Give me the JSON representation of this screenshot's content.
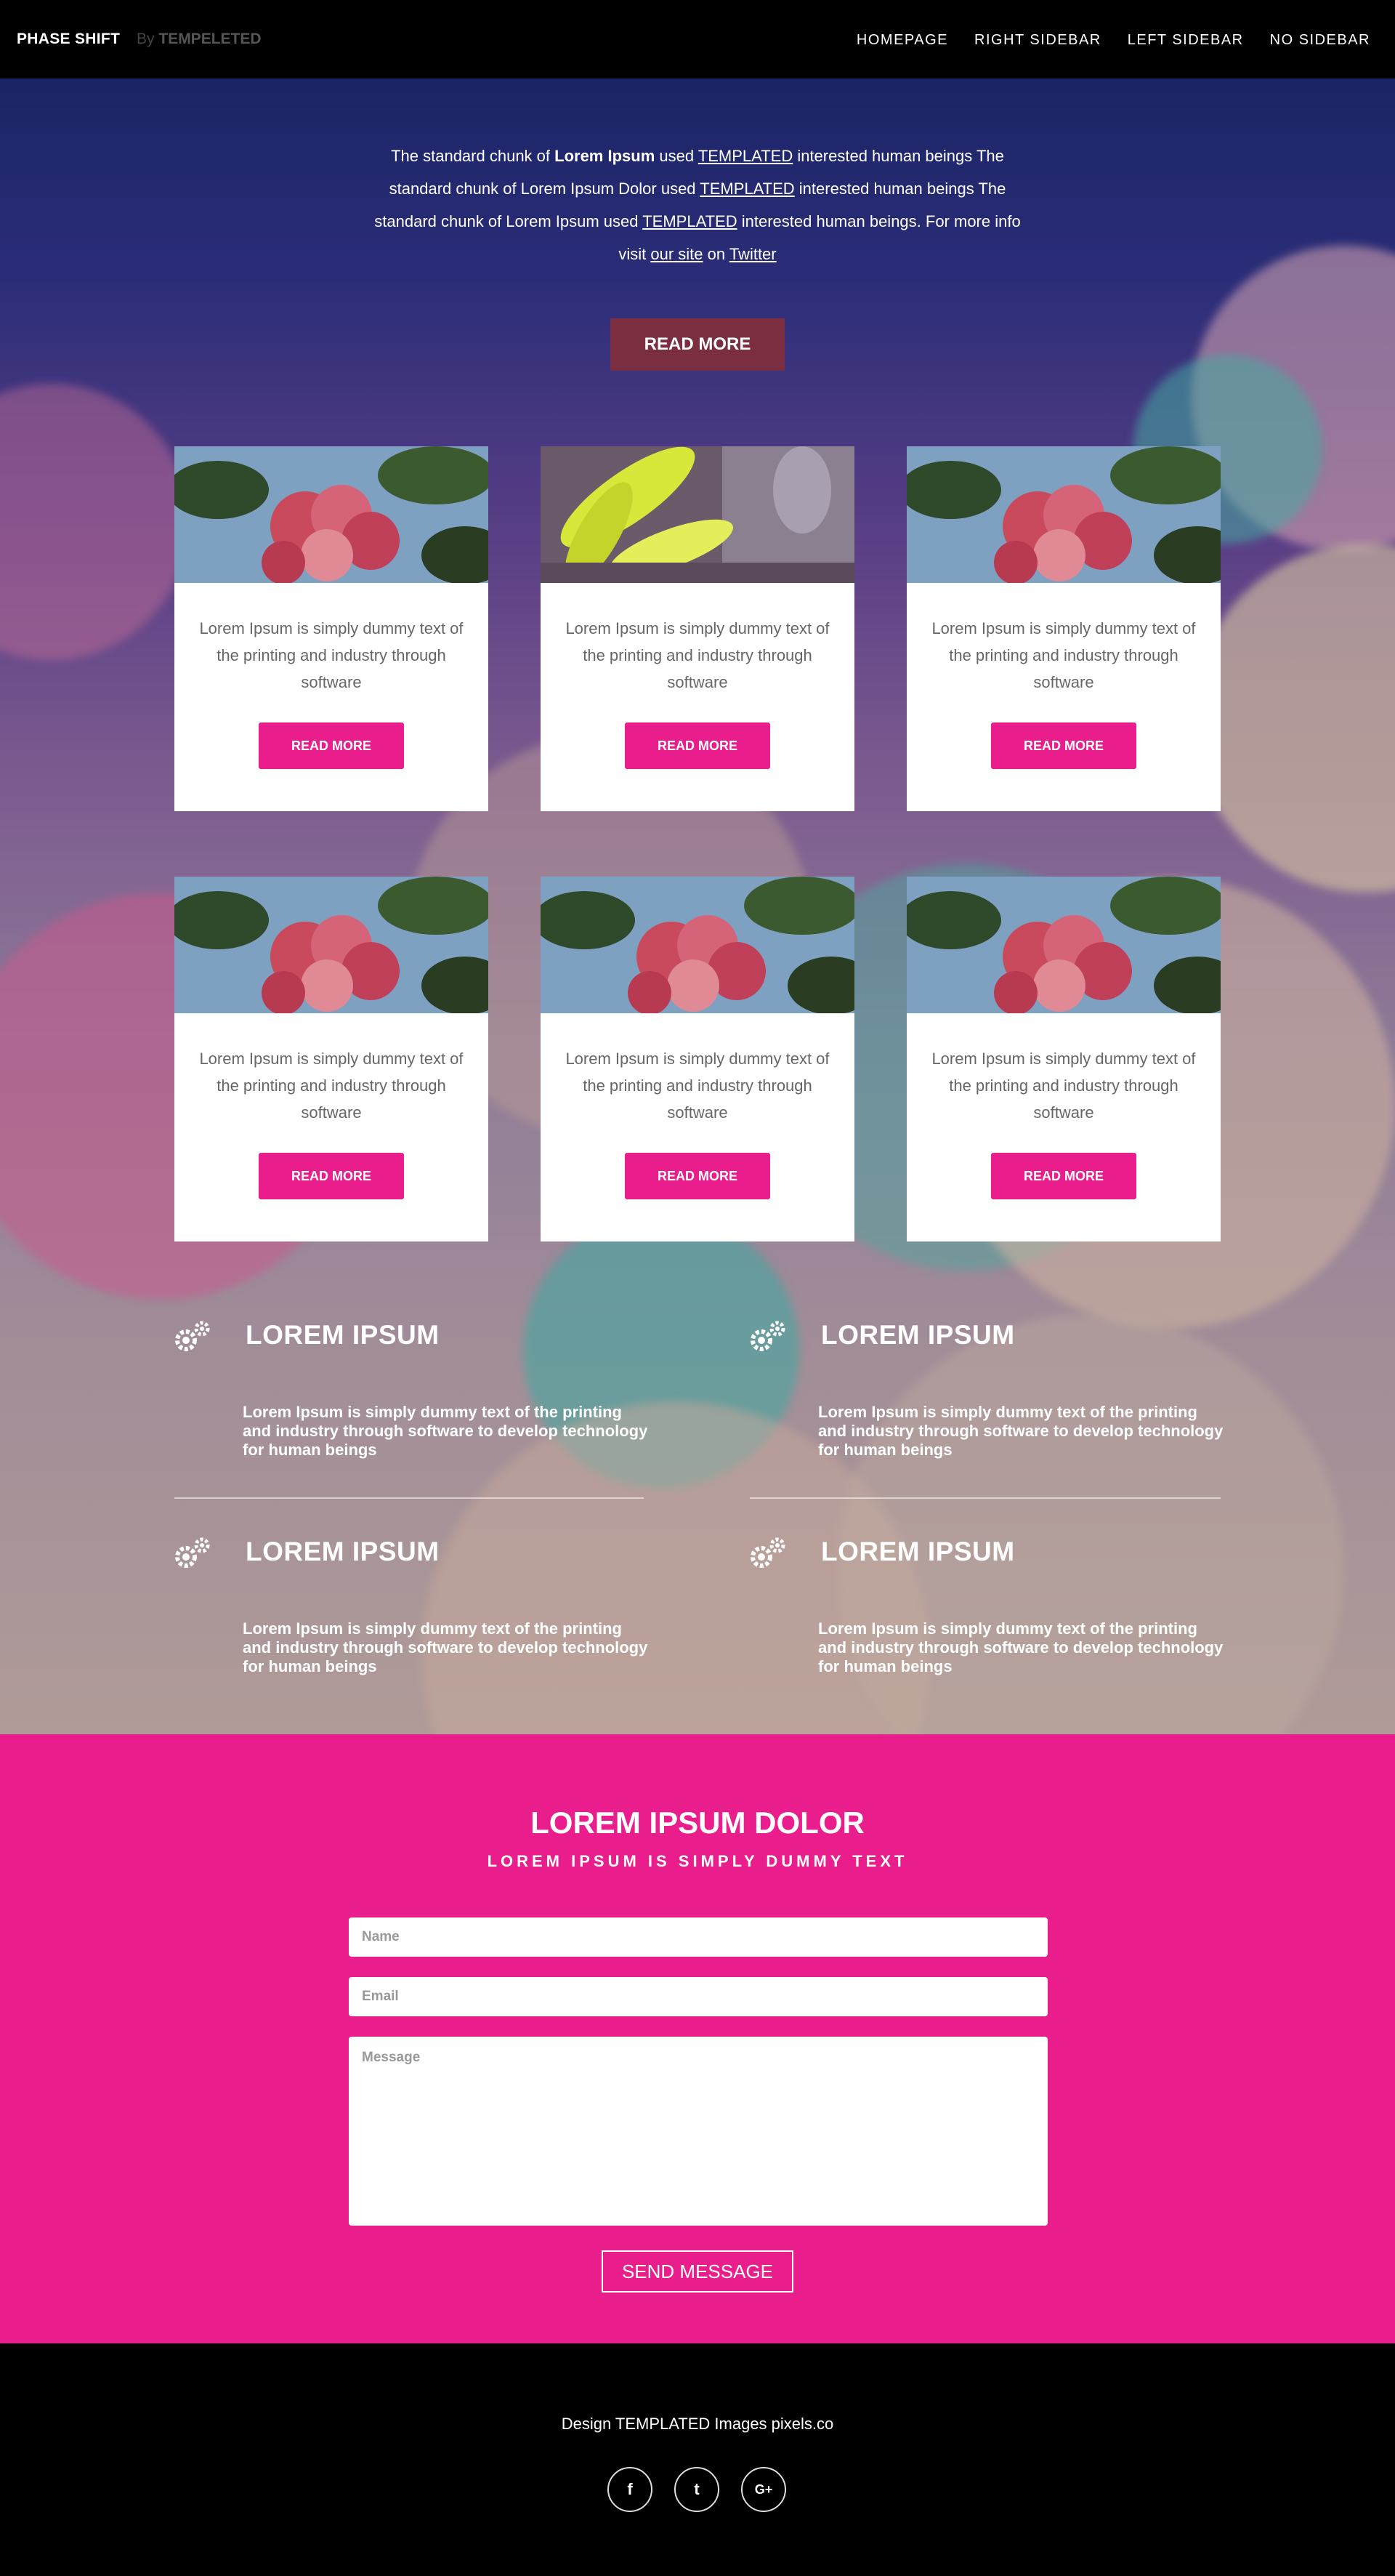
{
  "nav": {
    "brand": "PHASE SHIFT",
    "by_prefix": "By",
    "by_name": "TEMPELETED",
    "items": [
      "HOMEPAGE",
      "RIGHT SIDEBAR",
      "LEFT SIDEBAR",
      "NO SIDEBAR"
    ]
  },
  "hero": {
    "p1": "The standard chunk of ",
    "p1_bold": "Lorem Ipsum",
    "p2": " used ",
    "link1": "TEMPLATED",
    "p3": " interested human beings The standard chunk of Lorem Ipsum Dolor used ",
    "link2": "TEMPLATED",
    "p4": " interested human beings The standard chunk of Lorem Ipsum used ",
    "link3": "TEMPLATED",
    "p5": " interested human beings. For more info visit ",
    "link_site": "our site",
    "p6": " on ",
    "link_twitter": "Twitter",
    "button": "READ MORE"
  },
  "cards": [
    {
      "text": "Lorem Ipsum is simply dummy text of the printing and industry through software",
      "button": "READ MORE",
      "image": "pink-flower"
    },
    {
      "text": "Lorem Ipsum is simply dummy text of the printing and industry through software",
      "button": "READ MORE",
      "image": "yellow-leaves"
    },
    {
      "text": "Lorem Ipsum is simply dummy text of the printing and industry through software",
      "button": "READ MORE",
      "image": "pink-flower"
    },
    {
      "text": "Lorem Ipsum is simply dummy text of the printing and industry through software",
      "button": "READ MORE",
      "image": "pink-flower"
    },
    {
      "text": "Lorem Ipsum is simply dummy text of the printing and industry through software",
      "button": "READ MORE",
      "image": "pink-flower"
    },
    {
      "text": "Lorem Ipsum is simply dummy text of the printing and industry through software",
      "button": "READ MORE",
      "image": "pink-flower"
    }
  ],
  "features": [
    {
      "icon": "gears-icon",
      "title": "LOREM IPSUM",
      "text": "Lorem Ipsum is simply dummy text of the printing and industry through software to develop technology for human beings"
    },
    {
      "icon": "gears-icon",
      "title": "LOREM IPSUM",
      "text": "Lorem Ipsum is simply dummy text of the printing and industry through software to develop technology for human beings"
    },
    {
      "icon": "gears-icon",
      "title": "LOREM IPSUM",
      "text": "Lorem Ipsum is simply dummy text of the printing and industry through software to develop technology for human beings"
    },
    {
      "icon": "gears-icon",
      "title": "LOREM IPSUM",
      "text": "Lorem Ipsum is simply dummy text of the printing and industry through software to develop technology for human beings"
    }
  ],
  "contact": {
    "title": "LOREM IPSUM DOLOR",
    "subtitle": "LOREM IPSUM IS SIMPLY DUMMY TEXT",
    "name_placeholder": "Name",
    "email_placeholder": "Email",
    "message_placeholder": "Message",
    "send": "SEND MESSAGE",
    "accent": "#e91e8c"
  },
  "footer": {
    "credit": "Design TEMPLATED Images pixels.co",
    "social": [
      {
        "icon": "facebook-icon",
        "glyph": "f"
      },
      {
        "icon": "twitter-icon",
        "glyph": "t"
      },
      {
        "icon": "google-plus-icon",
        "glyph": "G+"
      }
    ]
  }
}
